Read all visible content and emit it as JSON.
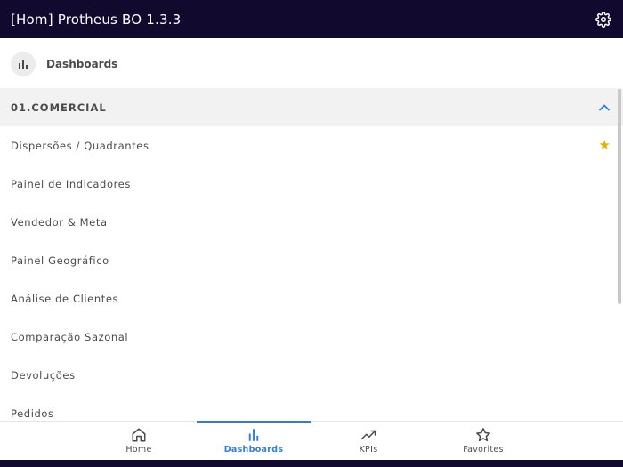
{
  "app": {
    "title": "[Hom] Protheus BO 1.3.3"
  },
  "section": {
    "title": "Dashboards"
  },
  "group": {
    "label": "01.COMERCIAL",
    "expanded": true
  },
  "items": [
    {
      "label": "Dispersões / Quadrantes",
      "favorite": true
    },
    {
      "label": "Painel de Indicadores",
      "favorite": false
    },
    {
      "label": "Vendedor & Meta",
      "favorite": false
    },
    {
      "label": "Painel Geográfico",
      "favorite": false
    },
    {
      "label": "Análise de Clientes",
      "favorite": false
    },
    {
      "label": "Comparação Sazonal",
      "favorite": false
    },
    {
      "label": "Devoluções",
      "favorite": false
    },
    {
      "label": "Pedidos",
      "favorite": false
    }
  ],
  "nav": [
    {
      "label": "Home",
      "icon": "home-icon",
      "active": false
    },
    {
      "label": "Dashboards",
      "icon": "bar-chart-icon",
      "active": true
    },
    {
      "label": "KPIs",
      "icon": "trending-up-icon",
      "active": false
    },
    {
      "label": "Favorites",
      "icon": "star-outline-icon",
      "active": false
    }
  ],
  "colors": {
    "app_bar": "#120a2e",
    "accent": "#2f7de1",
    "favorite_star": "#e5b100"
  }
}
